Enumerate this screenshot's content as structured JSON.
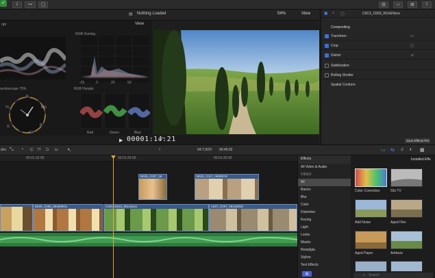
{
  "viewer": {
    "title": "Nothing Loaded",
    "zoom": "54%",
    "view_label": "View",
    "timecode": "00001:14:21"
  },
  "scopes": {
    "view_label": "View",
    "top_left_label": "rgb",
    "rgb_overlay_label": "RGB Overlay",
    "vectorscope_label": "vectorscope 75%",
    "rgb_parade_label": "RGB Parade",
    "overlay_ticks": [
      "-25",
      "0",
      "25",
      "50"
    ],
    "parade_channels": [
      "Red",
      "Green",
      "Blue"
    ],
    "vector_marks": [
      "R",
      "MG",
      "B",
      "YL",
      "G",
      "+CY"
    ]
  },
  "inspector": {
    "clip_name": "C0C3_C003_0514Z4zcs",
    "section": "Compositing",
    "rows": [
      {
        "label": "Transform",
        "checked": true
      },
      {
        "label": "Crop",
        "checked": true
      },
      {
        "label": "Distort",
        "checked": true
      },
      {
        "label": "Stabilization",
        "checked": false
      },
      {
        "label": "Rolling Shutter",
        "checked": false
      },
      {
        "label": "Spatial Conform",
        "checked": null
      }
    ],
    "save_button": "Save Effects Pre"
  },
  "timeline": {
    "index_label": "dex",
    "project_format": "04:7.0/2V",
    "duration": "00:45:02",
    "ruler_ticks": [
      "00:01:10:00",
      "00:01:20:00",
      "00:01:30:00"
    ],
    "clips": {
      "conn1": "B029_C007_0K",
      "conn2": "B029_C017_05/5ROG",
      "prim1": "B029_C005_051808Gx",
      "prim2": "C001C0023_0514Zacs",
      "prim3": "A027_C007_0514Z8Oc"
    }
  },
  "effects": {
    "header": "Effects",
    "installed_label": "Installed Effe",
    "categories": [
      "All Video & Audio",
      "VIDEO",
      "All",
      "Basics",
      "Blur",
      "Color",
      "Distortion",
      "Keying",
      "Light",
      "Looks",
      "Masks",
      "Nostalgia",
      "Stylize",
      "Text Effects"
    ],
    "selected": "All",
    "items": [
      "Color Correction",
      "50s TV",
      "Add Noise",
      "Aged Film",
      "Aged Paper",
      "Artifacts"
    ],
    "search_placeholder": "Search"
  },
  "colors": {
    "accent_blue": "#3d6fe0",
    "clip_blue": "#3a5a8a",
    "audio_green": "#2e7a3e",
    "playhead": "#e8a83a"
  }
}
